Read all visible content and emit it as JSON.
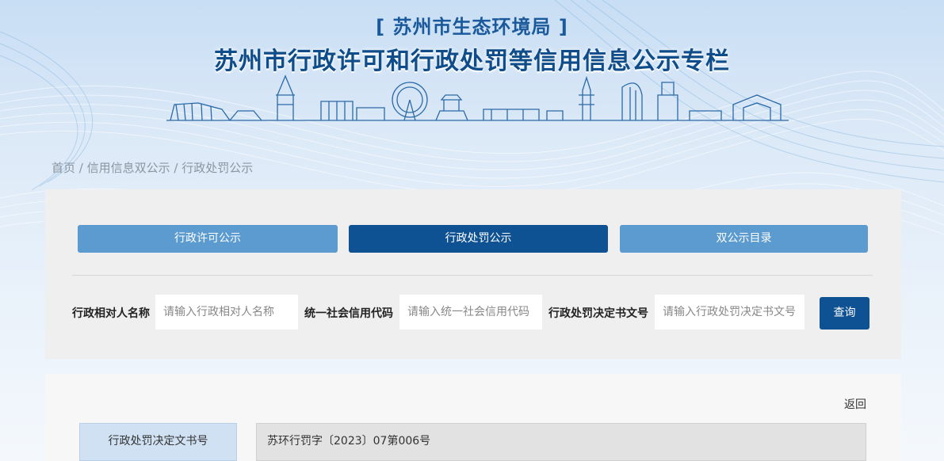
{
  "header": {
    "subtitle": "[ 苏州市生态环境局 ]",
    "title": "苏州市行政许可和行政处罚等信用信息公示专栏"
  },
  "breadcrumb": {
    "home": "首页",
    "sep1": " / ",
    "level2": "信用信息双公示",
    "sep2": " / ",
    "current": "行政处罚公示"
  },
  "tabs": [
    {
      "label": "行政许可公示",
      "active": false
    },
    {
      "label": "行政处罚公示",
      "active": true
    },
    {
      "label": "双公示目录",
      "active": false
    }
  ],
  "search": {
    "name_label": "行政相对人名称",
    "name_placeholder": "请输入行政相对人名称",
    "code_label": "统一社会信用代码",
    "code_placeholder": "请输入统一社会信用代码",
    "doc_label": "行政处罚决定书文号",
    "doc_placeholder": "请输入行政处罚决定书文号",
    "query_label": "查询"
  },
  "detail": {
    "back_label": "返回",
    "rows": [
      {
        "label": "行政处罚决定文书号",
        "value": "苏环行罚字〔2023〕07第006号"
      }
    ]
  },
  "colors": {
    "primary": "#0f5294",
    "tab_inactive": "#5b9bd0",
    "title": "#0f4c8a"
  }
}
